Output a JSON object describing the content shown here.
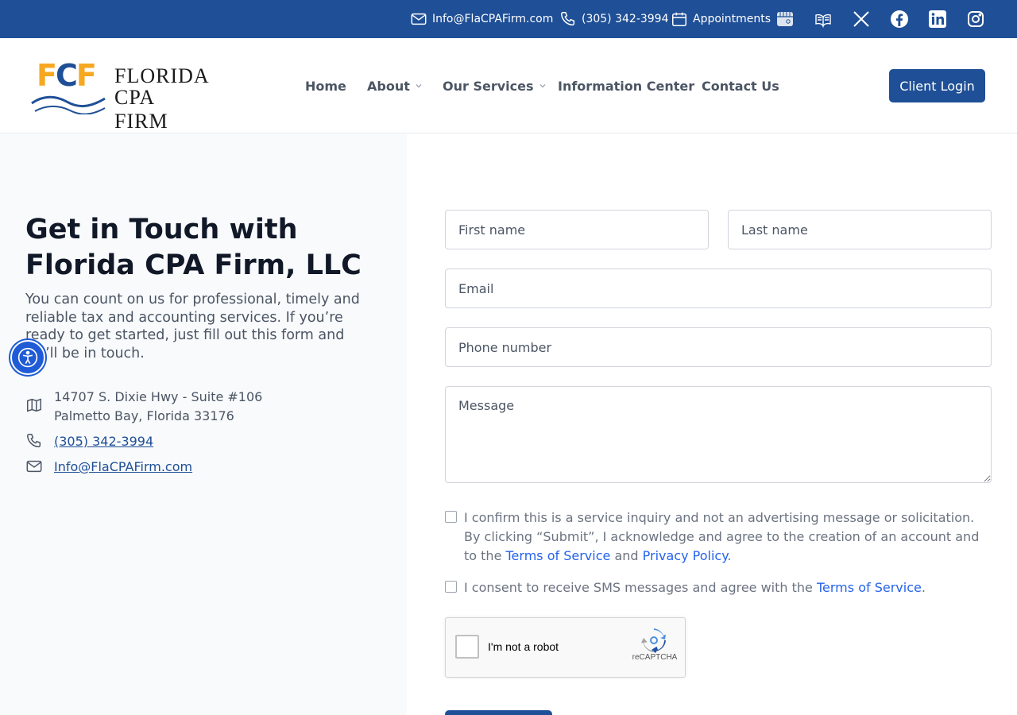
{
  "topbar": {
    "email": "Info@FlaCPAFirm.com",
    "phone": "(305) 342-3994",
    "appointments": "Appointments",
    "social_icons": [
      "google-business-icon",
      "yelp-icon",
      "x-icon",
      "facebook-icon",
      "linkedin-icon",
      "instagram-icon"
    ]
  },
  "header": {
    "logo_mark": "FCF",
    "logo_line1": "FLORIDA",
    "logo_line2": "CPA FIRM",
    "nav": [
      {
        "label": "Home",
        "has_dropdown": false
      },
      {
        "label": "About",
        "has_dropdown": true
      },
      {
        "label": "Our Services",
        "has_dropdown": true
      },
      {
        "label": "Information Center",
        "has_dropdown": false
      },
      {
        "label": "Contact Us",
        "has_dropdown": false
      }
    ],
    "login_label": "Client Login"
  },
  "contact": {
    "title_line1": "Get in Touch with",
    "title_line2": "Florida CPA Firm, LLC",
    "intro": "You can count on us for professional, timely and reliable tax and accounting services. If you’re ready to get started, just fill out this form and we’ll be in touch.",
    "address_line1": "14707 S. Dixie Hwy - Suite #106",
    "address_line2": "Palmetto Bay, Florida 33176",
    "phone": "(305) 342-3994",
    "email": "Info@FlaCPAFirm.com"
  },
  "form": {
    "first_name_placeholder": "First name",
    "last_name_placeholder": "Last name",
    "email_placeholder": "Email",
    "phone_placeholder": "Phone number",
    "message_placeholder": "Message",
    "consent1_text": "I confirm this is a service inquiry and not an advertising message or solicitation. By clicking “Submit”, I acknowledge and agree to the creation of an account and to the",
    "consent1_tos": "Terms of Service",
    "consent1_and": "and",
    "consent1_privacy": "Privacy Policy",
    "consent1_end": ".",
    "consent2_text": "I consent to receive SMS messages and agree with the",
    "consent2_tos": "Terms of Service",
    "consent2_end": ".",
    "captcha_label": "I'm not a robot",
    "captcha_brand": "reCAPTCHA"
  },
  "colors": {
    "brand_blue": "#1f4f96",
    "logo_orange": "#f6a821",
    "link_blue": "#2563eb",
    "accessibility_blue": "#1f5bd6"
  }
}
